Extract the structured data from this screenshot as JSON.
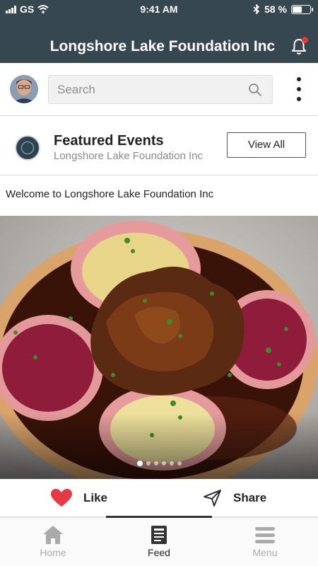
{
  "status_bar": {
    "carrier": "GS",
    "time": "9:41 AM",
    "battery": "58 %",
    "battery_level": 0.58
  },
  "app_bar": {
    "title": "Longshore Lake Foundation Inc",
    "notification_icon": "bell-icon",
    "has_notification_badge": true
  },
  "search": {
    "placeholder": "Search",
    "value": "",
    "icon": "search-icon"
  },
  "featured_events": {
    "title": "Featured Events",
    "subtitle": "Longshore Lake Foundation Inc",
    "view_all_label": "View All"
  },
  "post": {
    "text": "Welcome to Longshore Lake Foundation Inc",
    "carousel": {
      "total": 6,
      "active": 0
    }
  },
  "actions": {
    "like_label": "Like",
    "share_label": "Share"
  },
  "tabs": [
    {
      "label": "Home",
      "icon": "home-icon",
      "active": false
    },
    {
      "label": "Feed",
      "icon": "feed-icon",
      "active": true
    },
    {
      "label": "Menu",
      "icon": "menu-icon",
      "active": false
    }
  ],
  "colors": {
    "header": "#37474f",
    "like_heart": "#e53945",
    "badge": "#e53935"
  }
}
